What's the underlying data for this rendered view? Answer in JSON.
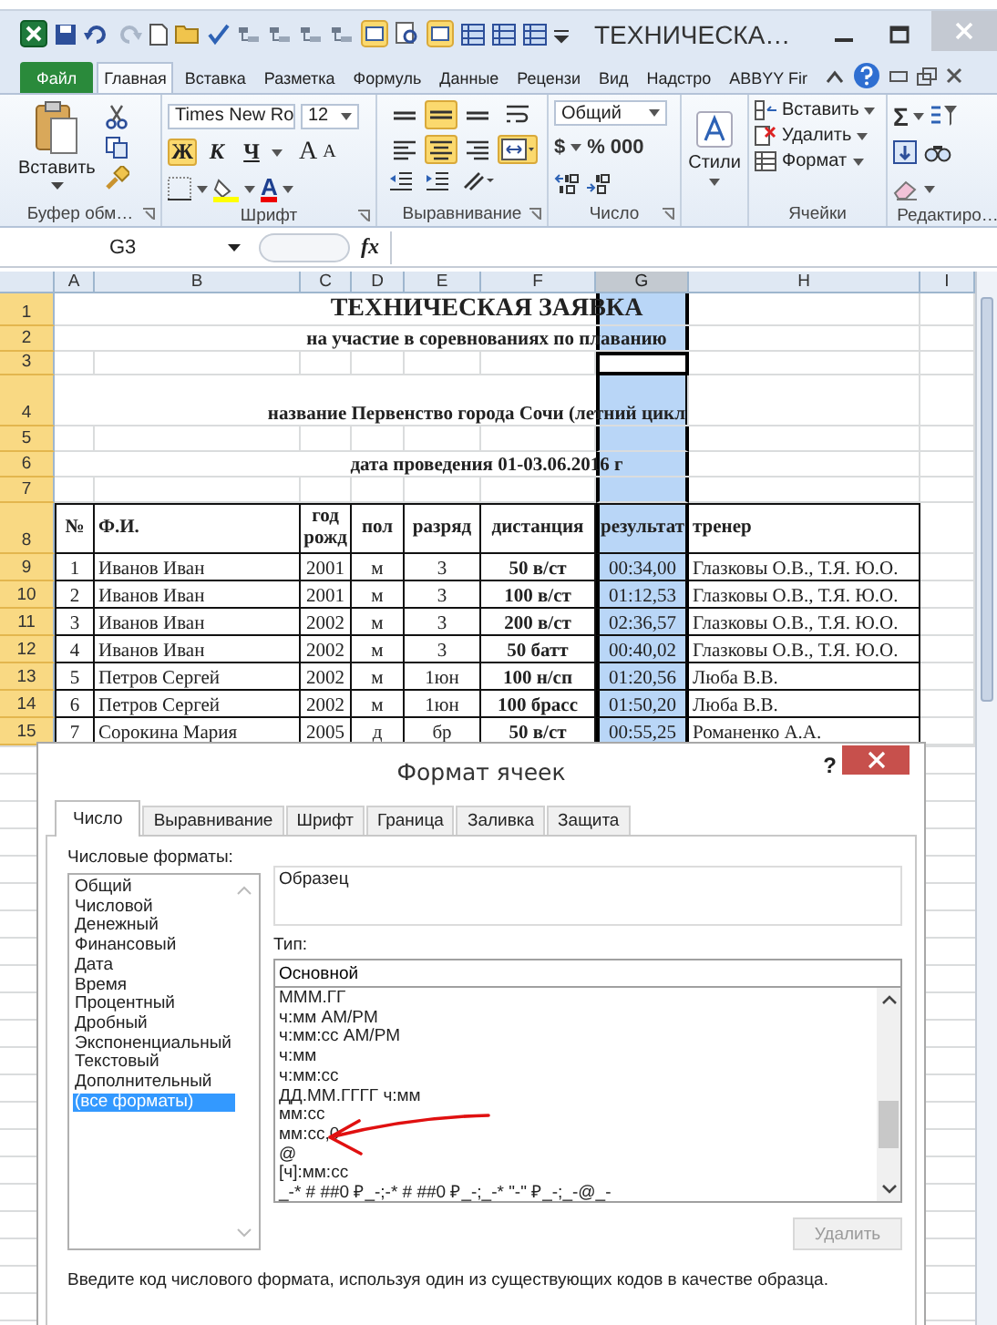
{
  "window": {
    "title": "ТЕХНИЧЕСКА…"
  },
  "ribbon_tabs": [
    {
      "label": "Файл",
      "kind": "file",
      "selected": false
    },
    {
      "label": "Главная",
      "kind": "tab",
      "selected": true
    },
    {
      "label": "Вставка",
      "kind": "tab",
      "selected": false
    },
    {
      "label": "Разметка",
      "kind": "tab",
      "selected": false
    },
    {
      "label": "Формуль",
      "kind": "tab",
      "selected": false
    },
    {
      "label": "Данные",
      "kind": "tab",
      "selected": false
    },
    {
      "label": "Рецензи",
      "kind": "tab",
      "selected": false
    },
    {
      "label": "Вид",
      "kind": "tab",
      "selected": false
    },
    {
      "label": "Надстро",
      "kind": "tab",
      "selected": false
    },
    {
      "label": "ABBYY Fir",
      "kind": "tab",
      "selected": false
    }
  ],
  "ribbon": {
    "clipboard": {
      "paste": "Вставить",
      "label": "Буфер обм…"
    },
    "font": {
      "name": "Times New Ro",
      "size": "12",
      "grow": "A",
      "shrink": "A",
      "color_glyph": "A",
      "label": "Шрифт",
      "styles": [
        {
          "glyph": "Ж",
          "kind": "bold",
          "on": true
        },
        {
          "glyph": "К",
          "kind": "italic",
          "on": false
        },
        {
          "glyph": "Ч",
          "kind": "underline",
          "on": false
        }
      ]
    },
    "alignment": {
      "label": "Выравнивание",
      "buttons": [
        {
          "kind": "top",
          "on": false
        },
        {
          "kind": "middle",
          "on": true
        },
        {
          "kind": "bottom",
          "on": false
        },
        {
          "kind": "wrap",
          "on": false
        },
        {
          "kind": "left",
          "on": false
        },
        {
          "kind": "center",
          "on": true
        },
        {
          "kind": "right",
          "on": false
        },
        {
          "kind": "merge",
          "on": true
        }
      ]
    },
    "number": {
      "format": "Общий",
      "currency": "$",
      "percent": "%",
      "thousands": "000",
      "label": "Число"
    },
    "styles": {
      "label": "Стили"
    },
    "cells": {
      "insert": "Вставить",
      "delete": "Удалить",
      "format": "Формат",
      "label": "Ячейки"
    },
    "editing": {
      "sum": "Σ",
      "label": "Редактиро…"
    }
  },
  "formula_bar": {
    "name_box": "G3",
    "fx": "fx"
  },
  "sheet": {
    "columns": [
      {
        "label": "A",
        "selected": false
      },
      {
        "label": "B",
        "selected": false
      },
      {
        "label": "C",
        "selected": false
      },
      {
        "label": "D",
        "selected": false
      },
      {
        "label": "E",
        "selected": false
      },
      {
        "label": "F",
        "selected": false
      },
      {
        "label": "G",
        "selected": true
      },
      {
        "label": "H",
        "selected": false
      },
      {
        "label": "I",
        "selected": false
      }
    ],
    "rows": [
      {
        "header": "1",
        "kind": "title",
        "active": false,
        "text": "ТЕХНИЧЕСКАЯ ЗАЯВКА"
      },
      {
        "header": "2",
        "kind": "subtitle",
        "active": false,
        "text": "на участие в соревнованиях по плаванию"
      },
      {
        "header": "3",
        "kind": "empty",
        "active": true
      },
      {
        "header": "4",
        "kind": "note",
        "active": false,
        "text": "название Первенство города Сочи  (летний цикл"
      },
      {
        "header": "5",
        "kind": "empty",
        "active": false
      },
      {
        "header": "6",
        "kind": "subtitle",
        "active": false,
        "text": "дата проведения   01-03.06.2016 г"
      },
      {
        "header": "7",
        "kind": "empty",
        "active": false
      },
      {
        "header": "8",
        "kind": "header",
        "active": false,
        "cells": [
          "№",
          "Ф.И.",
          "год рожд",
          "пол",
          "разряд",
          "дистанция",
          "результат",
          "тренер"
        ]
      },
      {
        "header": "9",
        "kind": "data",
        "active": false,
        "cells": [
          "1",
          "Иванов Иван",
          "2001",
          "м",
          "3",
          "50 в/ст",
          "00:34,00",
          "Глазковы О.В., Т.Я. Ю.О."
        ]
      },
      {
        "header": "10",
        "kind": "data",
        "active": false,
        "cells": [
          "2",
          "Иванов Иван",
          "2001",
          "м",
          "3",
          "100 в/ст",
          "01:12,53",
          "Глазковы О.В., Т.Я. Ю.О."
        ]
      },
      {
        "header": "11",
        "kind": "data",
        "active": false,
        "cells": [
          "3",
          "Иванов Иван",
          "2002",
          "м",
          "3",
          "200 в/ст",
          "02:36,57",
          "Глазковы О.В., Т.Я. Ю.О."
        ]
      },
      {
        "header": "12",
        "kind": "data",
        "active": false,
        "cells": [
          "4",
          "Иванов Иван",
          "2002",
          "м",
          "3",
          "50 батт",
          "00:40,02",
          "Глазковы О.В., Т.Я. Ю.О."
        ]
      },
      {
        "header": "13",
        "kind": "data",
        "active": false,
        "cells": [
          "5",
          "Петров Сергей",
          "2002",
          "м",
          "1юн",
          "100 н/сп",
          "01:20,56",
          "Люба В.В."
        ]
      },
      {
        "header": "14",
        "kind": "data",
        "active": false,
        "cells": [
          "6",
          "Петров Сергей",
          "2002",
          "м",
          "1юн",
          "100 брасс",
          "01:50,20",
          "Люба В.В."
        ]
      },
      {
        "header": "15",
        "kind": "data",
        "active": false,
        "cells": [
          "7",
          "Сорокина Мария",
          "2005",
          "д",
          "бр",
          "50 в/ст",
          "00:55,25",
          "Романенко А.А."
        ]
      }
    ]
  },
  "dialog": {
    "title": "Формат ячеек",
    "help": "?",
    "tabs": [
      {
        "label": "Число",
        "selected": true
      },
      {
        "label": "Выравнивание",
        "selected": false
      },
      {
        "label": "Шрифт",
        "selected": false
      },
      {
        "label": "Граница",
        "selected": false
      },
      {
        "label": "Заливка",
        "selected": false
      },
      {
        "label": "Защита",
        "selected": false
      }
    ],
    "categories_label": "Числовые форматы:",
    "categories": [
      {
        "label": "Общий",
        "selected": false
      },
      {
        "label": "Числовой",
        "selected": false
      },
      {
        "label": "Денежный",
        "selected": false
      },
      {
        "label": "Финансовый",
        "selected": false
      },
      {
        "label": "Дата",
        "selected": false
      },
      {
        "label": "Время",
        "selected": false
      },
      {
        "label": "Процентный",
        "selected": false
      },
      {
        "label": "Дробный",
        "selected": false
      },
      {
        "label": "Экспоненциальный",
        "selected": false
      },
      {
        "label": "Текстовый",
        "selected": false
      },
      {
        "label": "Дополнительный",
        "selected": false
      },
      {
        "label": "(все форматы)",
        "selected": true
      }
    ],
    "sample_label": "Образец",
    "type_label": "Тип:",
    "type_value": "Основной",
    "types": [
      "МММ.ГГ",
      "ч:мм AM/PM",
      "ч:мм:сс AM/PM",
      "ч:мм",
      "ч:мм:сс",
      "ДД.ММ.ГГГГ ч:мм",
      "мм:сс",
      "мм:сс,0",
      "@",
      "[ч]:мм:сс",
      "_-* # ##0 ₽_-;-* # ##0 ₽_-;_-* \"-\" ₽_-;_-@_-"
    ],
    "delete_button": {
      "label": "Удалить",
      "disabled": true
    },
    "hint": "Введите код числового формата, используя один из существующих кодов в качестве образца."
  }
}
